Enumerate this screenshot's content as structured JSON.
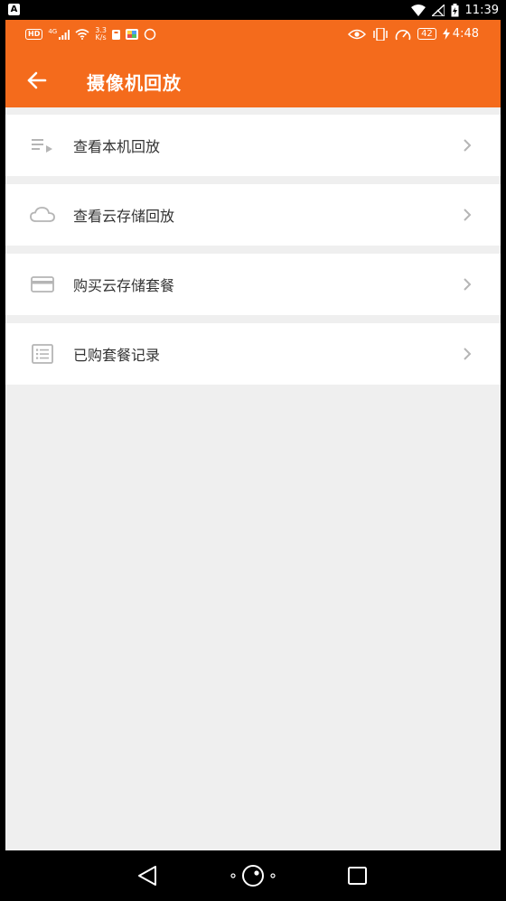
{
  "system_status": {
    "indicator": "A",
    "time": "11:39"
  },
  "inner_status": {
    "hd_badge": "HD",
    "network": "4G",
    "speed_value": "3.3",
    "speed_unit": "K/s",
    "battery": "42",
    "time": "4:48"
  },
  "header": {
    "title": "摄像机回放"
  },
  "menu": {
    "items": [
      {
        "label": "查看本机回放",
        "icon": "playlist-icon"
      },
      {
        "label": "查看云存储回放",
        "icon": "cloud-icon"
      },
      {
        "label": "购买云存储套餐",
        "icon": "credit-card-icon"
      },
      {
        "label": "已购套餐记录",
        "icon": "list-record-icon"
      }
    ]
  },
  "colors": {
    "accent": "#f46b1c",
    "background": "#efefef",
    "text": "#333333",
    "icon": "#b5b5b5"
  }
}
